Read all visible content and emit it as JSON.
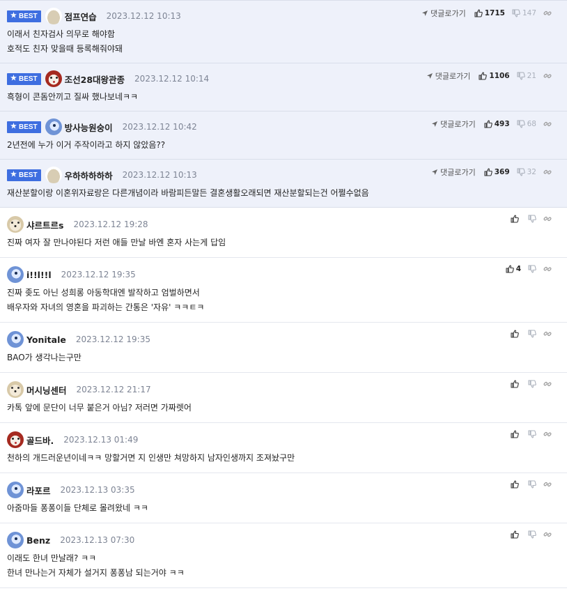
{
  "labels": {
    "best": "BEST",
    "reply": "댓글로가기"
  },
  "colors": {
    "best_badge": "#3e6ee0",
    "best_row_bg": "#eef1fa"
  },
  "best_comments": [
    {
      "nick": "점프연습",
      "avatar": "stone-avatar",
      "date": "2023.12.12 10:13",
      "likes": "1715",
      "dislikes": "147",
      "lines": [
        "이래서 친자검사 의무로 해야함",
        "호적도 친자 맞을때 등록해줘야돼"
      ]
    },
    {
      "nick": "조선28대왕관종",
      "avatar": "fox-avatar",
      "date": "2023.12.12 10:14",
      "likes": "1106",
      "dislikes": "21",
      "lines": [
        "흑형이 콘돔안끼고 질싸 했나보네ㅋㅋ"
      ]
    },
    {
      "nick": "방사능원숭이",
      "avatar": "ice-avatar",
      "date": "2023.12.12 10:42",
      "likes": "493",
      "dislikes": "68",
      "lines": [
        "2년전에 누가 이거 주작이라고 하지 않았음??"
      ]
    },
    {
      "nick": "우하하하하하",
      "avatar": "stone-avatar",
      "date": "2023.12.12 10:13",
      "likes": "369",
      "dislikes": "32",
      "lines": [
        "재산분할이랑 이혼위자료랑은 다른개념이라 바람피든말든 결혼생활오래되면 재산분할되는건 어쩔수없음"
      ]
    }
  ],
  "comments": [
    {
      "nick": "샤르트르s",
      "avatar": "dog-avatar",
      "date": "2023.12.12 19:28",
      "likes": "",
      "lines": [
        "진짜 여자 잘 만나야된다 저런 애들 만날 바엔 혼자 사는게 답임"
      ]
    },
    {
      "nick": "i!!l!!l",
      "avatar": "ice-avatar",
      "date": "2023.12.12 19:35",
      "likes": "4",
      "lines": [
        "진짜 좆도 아닌 성희롱 아동학대엔 발작하고 엄벌하면서",
        "배우자와 자녀의 영혼을 파괴하는 간통은 '자유' ㅋㅋㅌㅋ"
      ]
    },
    {
      "nick": "Yonitale",
      "avatar": "ice-avatar",
      "date": "2023.12.12 19:35",
      "likes": "",
      "lines": [
        "BAO가 생각나는구만"
      ]
    },
    {
      "nick": "머시닝센터",
      "avatar": "dog-avatar",
      "date": "2023.12.12 21:17",
      "likes": "",
      "lines": [
        "카톡 앞에 문단이 너무 붙은거 아님? 저러면 가짜렛어"
      ]
    },
    {
      "nick": "골드바.",
      "avatar": "fox-avatar",
      "date": "2023.12.13 01:49",
      "likes": "",
      "lines": [
        "천하의 개드러운년이네ㅋㅋ 망할거면 지 인생만 쳐망하지 남자인생까지 조져놨구만"
      ]
    },
    {
      "nick": "라포르",
      "avatar": "ice-avatar",
      "date": "2023.12.13 03:35",
      "likes": "",
      "lines": [
        "아줌마들 퐁퐁이들 단체로 몰려왔네 ㅋㅋ"
      ]
    },
    {
      "nick": "Benz",
      "avatar": "ice-avatar",
      "date": "2023.12.13 07:30",
      "likes": "",
      "lines": [
        "이래도 한녀 만날래? ㅋㅋ",
        "한녀 만나는거 자체가 설거지 퐁퐁남 되는거야 ㅋㅋ"
      ]
    }
  ]
}
